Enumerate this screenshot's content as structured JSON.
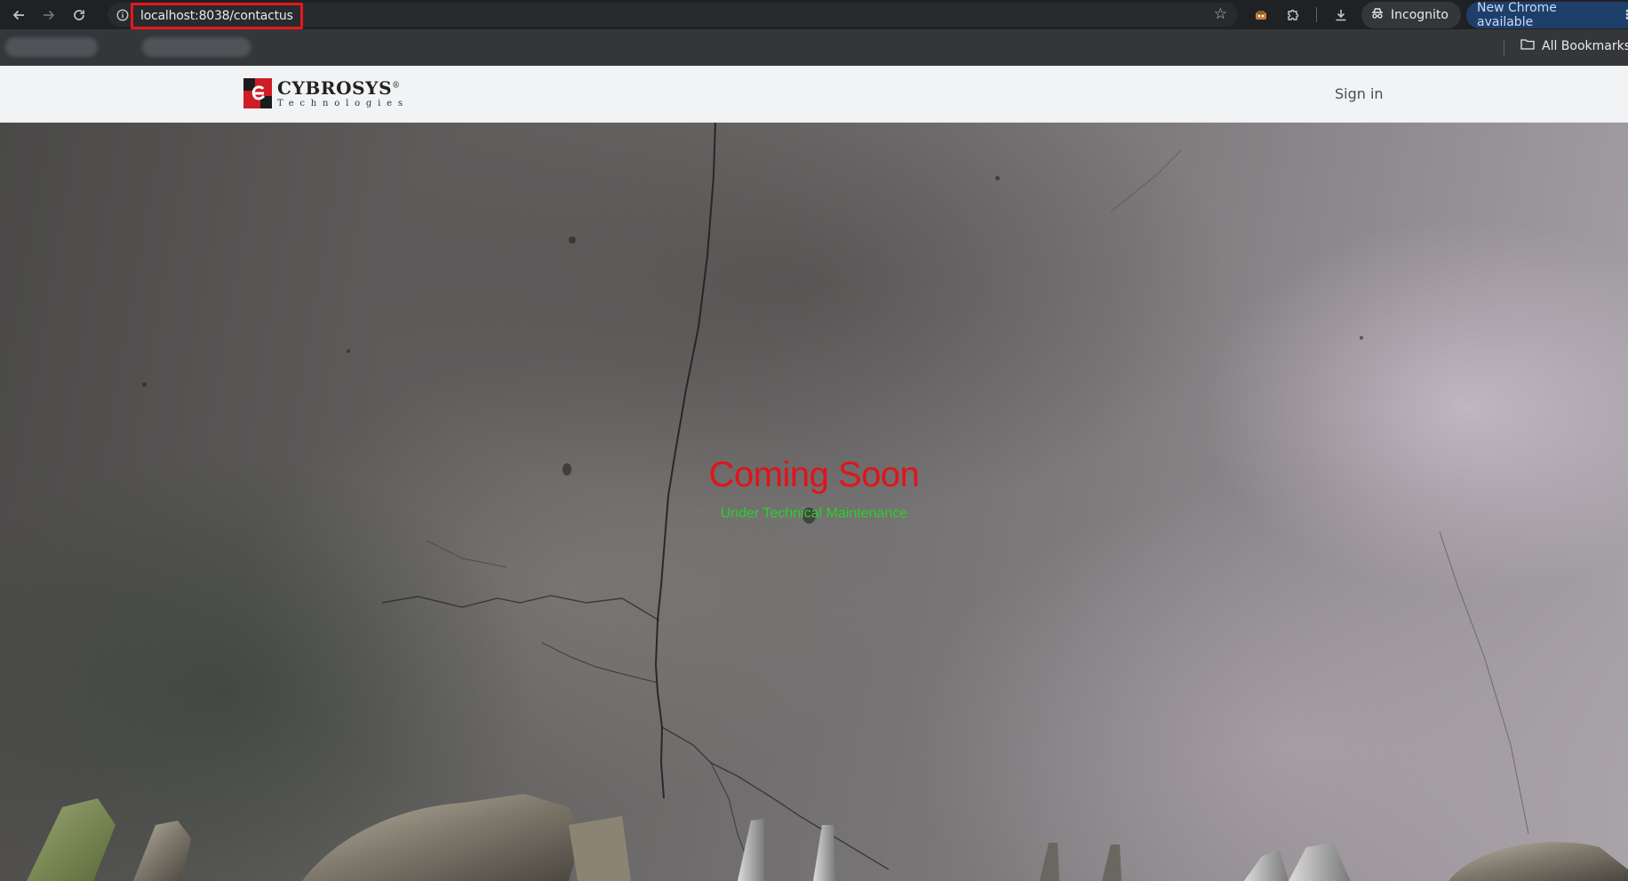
{
  "browser": {
    "url_host": "localhost",
    "url_path": ":8038/contactus",
    "incognito_label": "Incognito",
    "update_label": "New Chrome available",
    "bookmarks_label": "All Bookmarks",
    "icons": [
      "back-icon",
      "forward-icon",
      "reload-icon",
      "site-info-icon",
      "star-icon",
      "extension-icon",
      "puzzle-icon",
      "download-icon",
      "incognito-icon",
      "menu-icon",
      "folder-icon"
    ]
  },
  "site": {
    "logo_name": "CYBROSYS",
    "logo_registered": "®",
    "logo_sub": "Technologies",
    "signin_label": "Sign in",
    "brand_color": "#d01c24"
  },
  "hero": {
    "title": "Coming Soon",
    "subtitle": "Under Technical Maintenance",
    "title_color": "#e0141a",
    "subtitle_color": "#2bcf2b"
  }
}
